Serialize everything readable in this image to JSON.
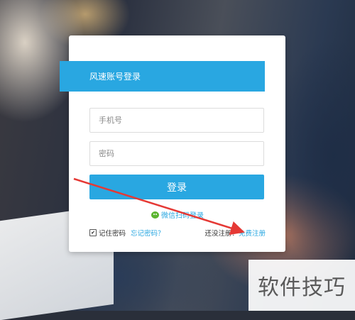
{
  "login": {
    "title": "风速账号登录",
    "phone_placeholder": "手机号",
    "password_placeholder": "密码",
    "login_button": "登录",
    "wechat_login": "微信扫码登录",
    "remember_label": "记住密码",
    "remember_checked": true,
    "forgot_link": "忘记密码？",
    "no_account_text": "还没注册？",
    "register_link": "免费注册"
  },
  "watermark": {
    "text": "软件技巧"
  },
  "colors": {
    "accent": "#29a7e1",
    "arrow": "#e53935",
    "wechat": "#5cb531"
  },
  "icons": {
    "wechat": "wechat-icon",
    "arrow": "red-arrow-annotation"
  }
}
